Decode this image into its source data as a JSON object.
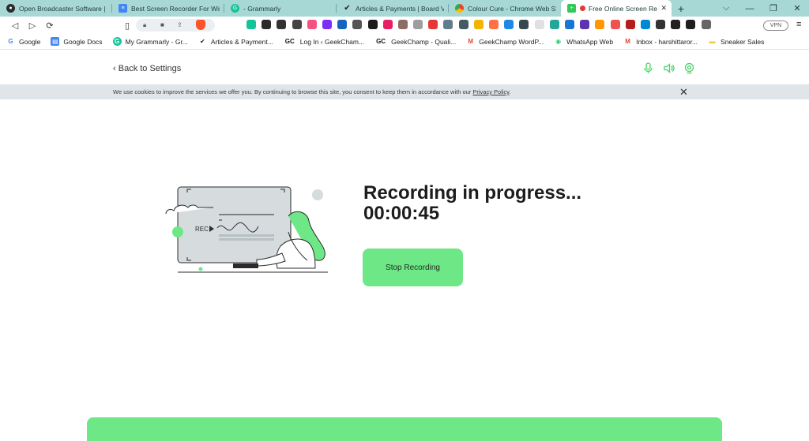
{
  "tabs": [
    {
      "title": "Open Broadcaster Software | OBS",
      "icon": "obs-icon",
      "color": "#2b2b2b"
    },
    {
      "title": "Best Screen Recorder For Windows",
      "icon": "docs-icon",
      "color": "#4285f4"
    },
    {
      "title": "- Grammarly",
      "icon": "grammarly-icon",
      "color": "#15c39a"
    },
    {
      "title": "Articles & Payments | Board View",
      "icon": "checkmark-icon",
      "color": "#222222"
    },
    {
      "title": "Colour Cure - Chrome Web Store",
      "icon": "webstore-icon",
      "color": "#f4b400"
    },
    {
      "title": "Free Online Screen Recorder",
      "icon": "plus-green-icon",
      "color": "#34c759",
      "active": true
    }
  ],
  "window_controls": {
    "chevron": "⌵",
    "minimize": "—",
    "restore": "❐",
    "close": "✕"
  },
  "toolbar": {
    "back": "◁",
    "forward": "▷",
    "reload": "⟳",
    "vpn_label": "VPN",
    "menu": "≡"
  },
  "extension_colors": [
    "#15c39a",
    "#2b2b2b",
    "#333333",
    "#444444",
    "#f55283",
    "#7b2ff7",
    "#1565c0",
    "#555555",
    "#1c1c1c",
    "#e91e63",
    "#8d6e63",
    "#9e9e9e",
    "#e53935",
    "#607d8b",
    "#455a64",
    "#f4b400",
    "#ff7043",
    "#1e88e5",
    "#37474f",
    "#e0e0e0",
    "#26a69a",
    "#1976d2",
    "#5e35b1",
    "#ff9800",
    "#ef5350",
    "#b71c1c",
    "#0288d1",
    "#333333",
    "#222222",
    "#1e1e1e",
    "#666666"
  ],
  "bookmarks": [
    {
      "label": "Google",
      "glyph": "G",
      "color": "#4285f4"
    },
    {
      "label": "Google Docs",
      "glyph": "▤",
      "color": "#4285f4"
    },
    {
      "label": "My Grammarly - Gr...",
      "glyph": "G",
      "color": "#15c39a"
    },
    {
      "label": "Articles & Payment...",
      "glyph": "✔",
      "color": "#222222"
    },
    {
      "label": "Log In ‹ GeekCham...",
      "glyph": "GC",
      "color": "#111111"
    },
    {
      "label": "GeekChamp - Quali...",
      "glyph": "GC",
      "color": "#111111"
    },
    {
      "label": "GeekChamp WordP...",
      "glyph": "M",
      "color": "#ea4335"
    },
    {
      "label": "WhatsApp Web",
      "glyph": "◉",
      "color": "#25d366"
    },
    {
      "label": "Inbox - harshittaror...",
      "glyph": "M",
      "color": "#ea4335"
    },
    {
      "label": "Sneaker Sales",
      "glyph": "▬",
      "color": "#f4c542"
    }
  ],
  "page": {
    "back_label": "Back to Settings",
    "cookie_text": "We use cookies to improve the services we offer you. By continuing to browse this site, you consent to keep them in accordance with our ",
    "cookie_link": "Privacy Policy",
    "cookie_end": ".",
    "illustration_label": "REC",
    "status_title": "Recording in progress...",
    "timer": "00:00:45",
    "stop_button": "Stop Recording",
    "accent": "#6ee787"
  }
}
